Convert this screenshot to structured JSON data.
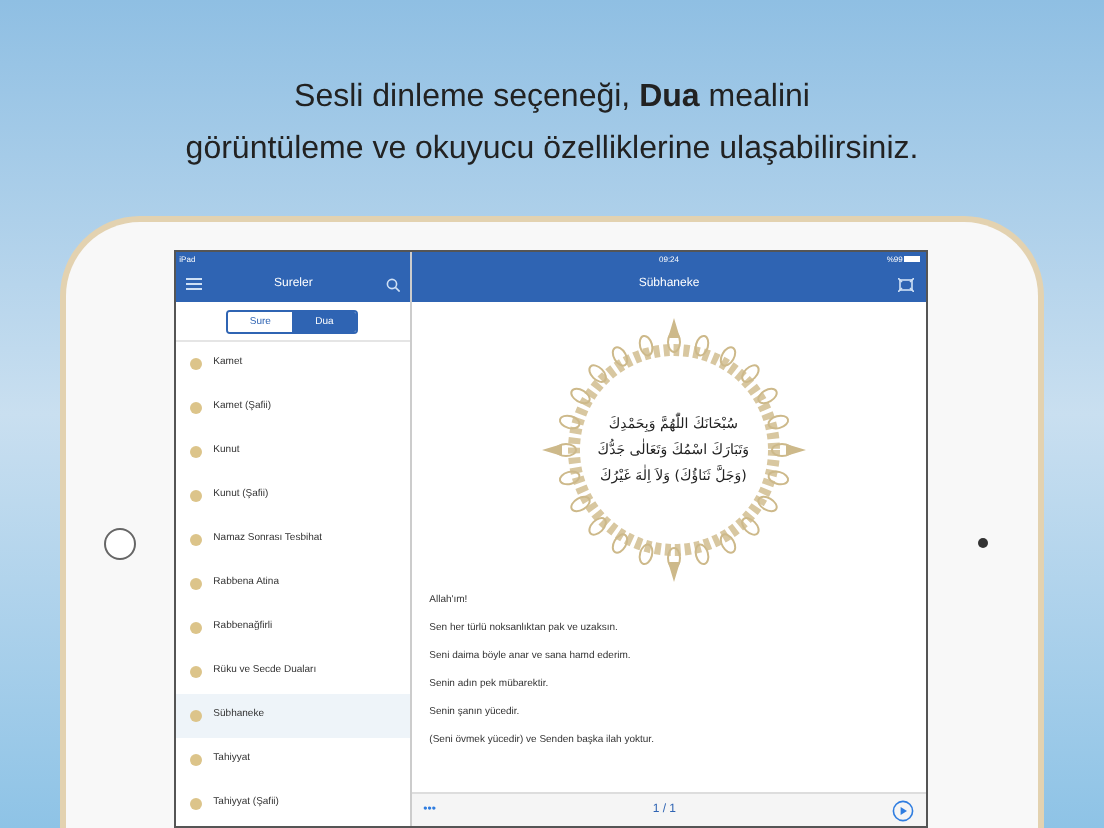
{
  "headline": {
    "lines": [
      "Sesli dinleme seçeneği, **Dua** mealini",
      "görüntüleme ve okuyucu özelliklerine ulaşabilirsiniz."
    ]
  },
  "status_bar": {
    "device": "iPad",
    "time": "09:24",
    "battery": "%99"
  },
  "sidebar": {
    "title": "Sureler",
    "segments": [
      {
        "label": "Sure",
        "selected": false
      },
      {
        "label": "Dua",
        "selected": true
      }
    ],
    "items": [
      {
        "label": "Kamet",
        "selected": false
      },
      {
        "label": "Kamet (Şafii)",
        "selected": false
      },
      {
        "label": "Kunut",
        "selected": false
      },
      {
        "label": "Kunut (Şafii)",
        "selected": false
      },
      {
        "label": "Namaz Sonrası Tesbihat",
        "selected": false
      },
      {
        "label": "Rabbena Atina",
        "selected": false
      },
      {
        "label": "Rabbenağfirli",
        "selected": false
      },
      {
        "label": "Rüku ve Secde Duaları",
        "selected": false
      },
      {
        "label": "Sübhaneke",
        "selected": true
      },
      {
        "label": "Tahiyyat",
        "selected": false
      },
      {
        "label": "Tahiyyat (Şafii)",
        "selected": false
      }
    ]
  },
  "detail": {
    "title": "Sübhaneke",
    "arabic_lines": [
      "سُبْحَانَكَ اللّٰهُمَّ وَبِحَمْدِكَ",
      "وَتَبَارَكَ اسْمُكَ وَتَعَالٰى جَدُّكَ",
      "(وَجَلَّ ثَنَاؤُكَ) وَلاَ اِلٰهَ غَيْرُكَ"
    ],
    "meaning_lines": [
      "Allah'ım!",
      "Sen her türlü noksanlıktan pak ve uzaksın.",
      "Seni daima böyle anar ve sana hamd ederim.",
      "Senin adın pek mübarektir.",
      "Senin şanın yücedir.",
      "(Seni övmek yücedir) ve Senden başka ilah yoktur."
    ],
    "toolbar": {
      "more": "•••",
      "page": "1 / 1"
    }
  }
}
